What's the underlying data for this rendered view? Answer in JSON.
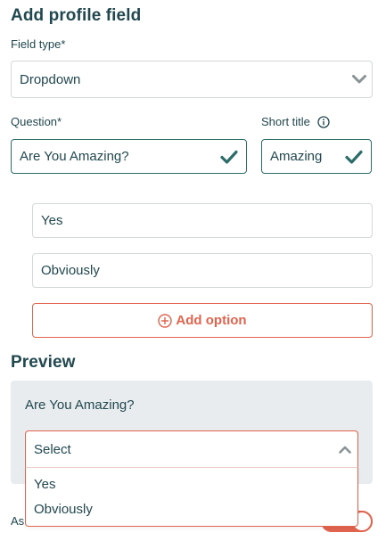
{
  "form": {
    "title": "Add profile field",
    "field_type_label": "Field type*",
    "field_type_value": "Dropdown",
    "question_label": "Question*",
    "question_value": "Are You Amazing?",
    "short_title_label": "Short title",
    "short_title_value": "Amazing",
    "options": [
      "Yes",
      "Obviously"
    ],
    "add_option_label": "Add option"
  },
  "preview": {
    "title": "Preview",
    "question": "Are You Amazing?",
    "select_placeholder": "Select",
    "dropdown_options": [
      "Yes",
      "Obviously"
    ],
    "partial_label": "As"
  },
  "colors": {
    "primary_dark": "#21484f",
    "valid_green": "#2d6d69",
    "accent_coral": "#e0644e",
    "preview_bg": "#e9ecee"
  },
  "icons": {
    "field_type_chevron": "chevron-down-icon",
    "question_valid": "check-icon",
    "short_title_info": "info-icon",
    "short_title_valid": "check-icon",
    "add_option": "plus-circle-icon",
    "select_chevron": "chevron-up-icon"
  }
}
